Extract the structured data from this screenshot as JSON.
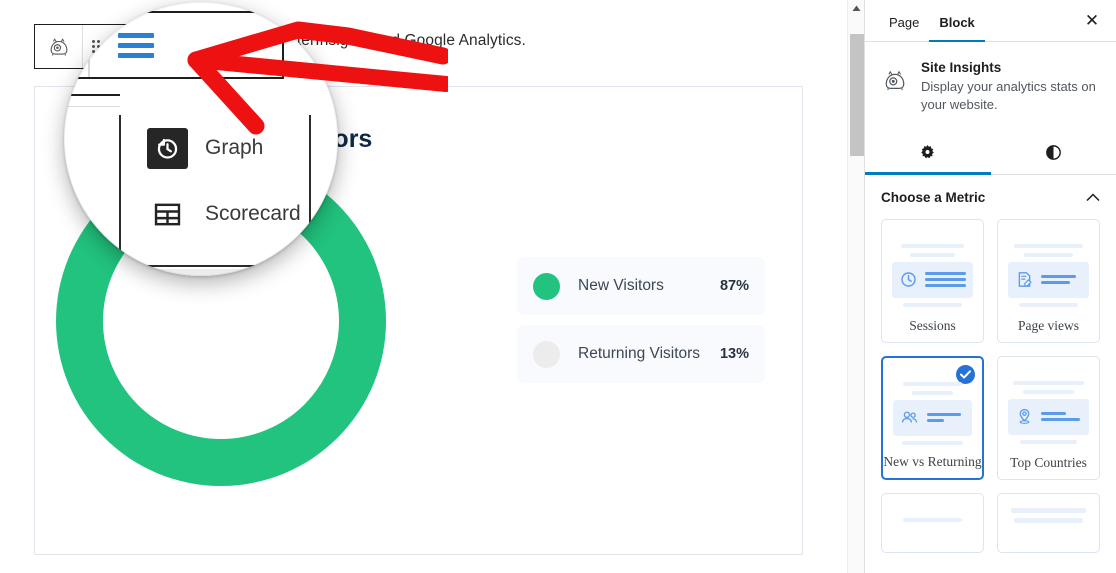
{
  "editor": {
    "intro_text": "…MonsterInsights and Google Analytics.",
    "toolbar": {
      "block_icon_name": "monsterinsights-logo-icon",
      "drag_handle_name": "drag-handle-icon",
      "hamburger_label": "Options"
    },
    "card": {
      "title": "New vs Returning Visitors",
      "chart_colors": {
        "new": "#21c37e",
        "returning": "#ececec"
      }
    },
    "legend": [
      {
        "label": "New Visitors",
        "value": "87%",
        "color": "#21c37e"
      },
      {
        "label": "Returning Visitors",
        "value": "13%",
        "color": "#ececec"
      }
    ]
  },
  "magnifier": {
    "menu_items": [
      {
        "label": "Graph",
        "icon": "clock-history-icon",
        "selected": true
      },
      {
        "label": "Scorecard",
        "icon": "table-grid-icon",
        "selected": false
      }
    ]
  },
  "sidebar": {
    "tabs": [
      {
        "label": "Page",
        "active": false
      },
      {
        "label": "Block",
        "active": true
      }
    ],
    "close_label": "✕",
    "block": {
      "title": "Site Insights",
      "description": "Display your analytics stats on your website.",
      "icon": "monsterinsights-logo-icon"
    },
    "icon_tabs": [
      {
        "icon": "gear-icon",
        "name": "settings-tab",
        "active": true
      },
      {
        "icon": "contrast-icon",
        "name": "styles-tab",
        "active": false
      }
    ],
    "metric_section": {
      "title": "Choose a Metric",
      "collapse_icon": "chevron-up-icon",
      "cards": [
        {
          "label": "Sessions",
          "icon": "clock-list-icon",
          "selected": false,
          "partial": false
        },
        {
          "label": "Page views",
          "icon": "document-edit-icon",
          "selected": false,
          "partial": false
        },
        {
          "label": "New vs Returning",
          "icon": "users-icon",
          "selected": true,
          "partial": false
        },
        {
          "label": "Top Countries",
          "icon": "map-pin-icon",
          "selected": false,
          "partial": false
        },
        {
          "label": "",
          "icon": "",
          "selected": false,
          "partial": true
        },
        {
          "label": "",
          "icon": "",
          "selected": false,
          "partial": true
        }
      ]
    }
  },
  "annotation": {
    "arrow_color": "#ee1111",
    "points_at": "block-options-hamburger-button"
  },
  "chart_data": {
    "type": "pie",
    "title": "New vs Returning Visitors",
    "categories": [
      "New Visitors",
      "Returning Visitors"
    ],
    "values": [
      87,
      13
    ],
    "unit": "%",
    "colors": [
      "#21c37e",
      "#ececec"
    ],
    "donut": true,
    "inner_radius_ratio": 0.72,
    "legend_position": "right",
    "grid": false
  }
}
